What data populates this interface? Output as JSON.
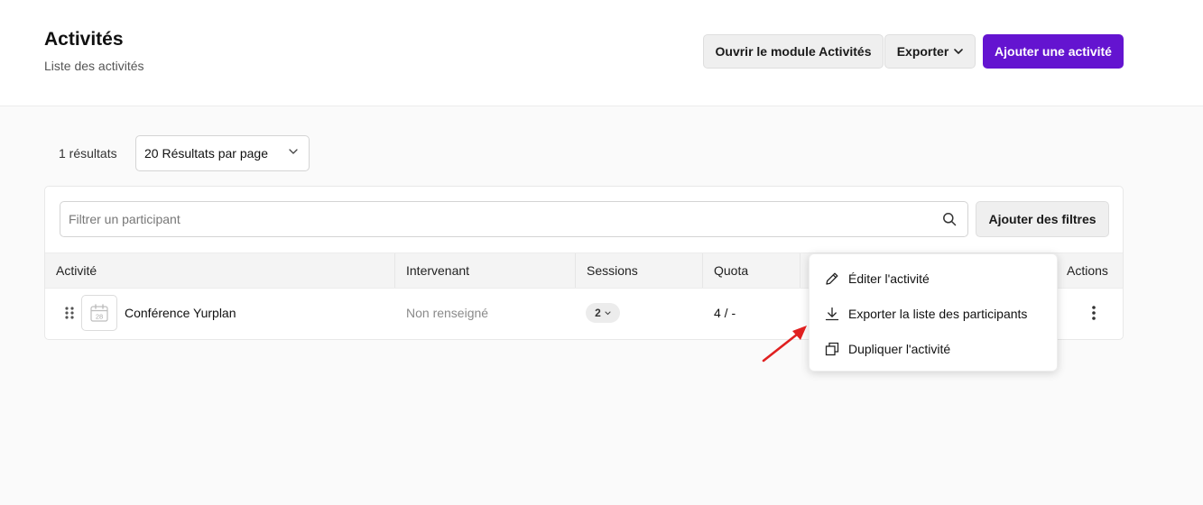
{
  "header": {
    "title": "Activités",
    "subtitle": "Liste des activités",
    "open_module_label": "Ouvrir le module Activités",
    "export_label": "Exporter",
    "add_activity_label": "Ajouter une activité"
  },
  "toolbar": {
    "results_count": "1 résultats",
    "per_page_value": "20 Résultats par page"
  },
  "filters": {
    "search_placeholder": "Filtrer un participant",
    "add_filters_label": "Ajouter des filtres"
  },
  "table": {
    "columns": [
      "Activité",
      "Intervenant",
      "Sessions",
      "Quota",
      "Actions"
    ],
    "rows": [
      {
        "name": "Conférence Yurplan",
        "calendar_day": "28",
        "intervenant": "Non renseigné",
        "sessions": "2",
        "quota": "4 / -"
      }
    ]
  },
  "actions_menu": {
    "items": [
      {
        "label": "Éditer l'activité",
        "icon": "pencil-icon"
      },
      {
        "label": "Exporter la liste des participants",
        "icon": "download-icon"
      },
      {
        "label": "Dupliquer l'activité",
        "icon": "duplicate-icon"
      }
    ]
  },
  "colors": {
    "primary": "#6414d0",
    "annotation_arrow": "#e02020"
  }
}
